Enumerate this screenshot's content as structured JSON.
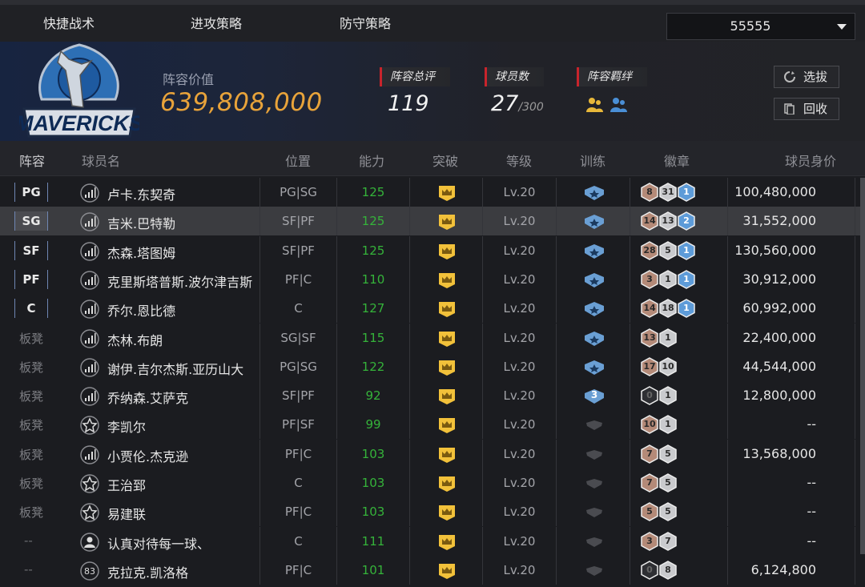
{
  "tabs": [
    "快捷战术",
    "进攻策略",
    "防守策略"
  ],
  "selector": {
    "value": "55555"
  },
  "team": {
    "value_label": "阵容价值",
    "value": "639,808,000",
    "stats": [
      {
        "label": "阵容总评",
        "value": "119"
      },
      {
        "label": "球员数",
        "value": "27",
        "sub": "/300"
      },
      {
        "label": "阵容羁绊"
      }
    ],
    "buttons": {
      "draft": "选拔",
      "recycle": "回收"
    }
  },
  "columns": [
    "阵容",
    "球员名",
    "位置",
    "能力",
    "突破",
    "等级",
    "训练",
    "徽章",
    "球员身价"
  ],
  "colors": {
    "accent": "#e8a33a",
    "ability": "#35b33a",
    "crown": "#f2c13a",
    "train_blue": "#6a9fd4",
    "train_dark": "#5a5b60",
    "stat_bar": "#c8242c"
  },
  "rows": [
    {
      "slot": "PG",
      "slot_type": "badge",
      "icon": "signal-icon",
      "name": "卢卡.东契奇",
      "pos": "PG|SG",
      "ability": "125",
      "level": "Lv.20",
      "train": "blue",
      "train_num": "",
      "badges": [
        {
          "n": "8",
          "c": "bronze"
        },
        {
          "n": "31",
          "c": "silver"
        },
        {
          "n": "1",
          "c": "blue"
        }
      ],
      "price": "100,480,000"
    },
    {
      "slot": "SG",
      "slot_type": "badge",
      "icon": "signal-icon",
      "name": "吉米.巴特勒",
      "pos": "SF|PF",
      "ability": "125",
      "level": "Lv.20",
      "train": "blue",
      "train_num": "",
      "badges": [
        {
          "n": "14",
          "c": "bronze"
        },
        {
          "n": "13",
          "c": "silver"
        },
        {
          "n": "2",
          "c": "blue"
        }
      ],
      "price": "31,552,000"
    },
    {
      "slot": "SF",
      "slot_type": "badge",
      "icon": "signal-icon",
      "name": "杰森.塔图姆",
      "pos": "SF|PF",
      "ability": "125",
      "level": "Lv.20",
      "train": "blue",
      "train_num": "",
      "badges": [
        {
          "n": "28",
          "c": "bronze"
        },
        {
          "n": "5",
          "c": "silver"
        },
        {
          "n": "1",
          "c": "blue"
        }
      ],
      "price": "130,560,000"
    },
    {
      "slot": "PF",
      "slot_type": "badge",
      "icon": "signal-icon",
      "name": "克里斯塔普斯.波尔津吉斯",
      "pos": "PF|C",
      "ability": "110",
      "level": "Lv.20",
      "train": "blue",
      "train_num": "",
      "badges": [
        {
          "n": "3",
          "c": "bronze"
        },
        {
          "n": "1",
          "c": "silver"
        },
        {
          "n": "1",
          "c": "blue"
        }
      ],
      "price": "30,912,000"
    },
    {
      "slot": "C",
      "slot_type": "badge",
      "icon": "signal-icon",
      "name": "乔尔.恩比德",
      "pos": "C",
      "ability": "127",
      "level": "Lv.20",
      "train": "blue",
      "train_num": "",
      "badges": [
        {
          "n": "14",
          "c": "bronze"
        },
        {
          "n": "18",
          "c": "silver"
        },
        {
          "n": "1",
          "c": "blue"
        }
      ],
      "price": "60,992,000"
    },
    {
      "slot": "板凳",
      "slot_type": "bench",
      "icon": "signal-icon",
      "name": "杰林.布朗",
      "pos": "SG|SF",
      "ability": "115",
      "level": "Lv.20",
      "train": "blue",
      "train_num": "",
      "badges": [
        {
          "n": "13",
          "c": "bronze"
        },
        {
          "n": "1",
          "c": "silver"
        }
      ],
      "price": "22,400,000"
    },
    {
      "slot": "板凳",
      "slot_type": "bench",
      "icon": "signal-icon",
      "name": "谢伊.吉尔杰斯.亚历山大",
      "pos": "PG|SG",
      "ability": "122",
      "level": "Lv.20",
      "train": "blue",
      "train_num": "",
      "badges": [
        {
          "n": "17",
          "c": "bronze"
        },
        {
          "n": "10",
          "c": "silver"
        }
      ],
      "price": "44,544,000"
    },
    {
      "slot": "板凳",
      "slot_type": "bench",
      "icon": "signal-icon",
      "name": "乔纳森.艾萨克",
      "pos": "SF|PF",
      "ability": "92",
      "level": "Lv.20",
      "train": "blue",
      "train_num": "3",
      "badges": [
        {
          "n": "0",
          "c": "dark"
        },
        {
          "n": "1",
          "c": "silver"
        }
      ],
      "price": "12,800,000"
    },
    {
      "slot": "板凳",
      "slot_type": "bench",
      "icon": "star-icon",
      "name": "李凯尔",
      "pos": "PF|SF",
      "ability": "99",
      "level": "Lv.20",
      "train": "dark",
      "train_num": "",
      "badges": [
        {
          "n": "10",
          "c": "bronze"
        },
        {
          "n": "1",
          "c": "silver"
        }
      ],
      "price": "--"
    },
    {
      "slot": "板凳",
      "slot_type": "bench",
      "icon": "signal-icon",
      "name": "小贾伦.杰克逊",
      "pos": "PF|C",
      "ability": "103",
      "level": "Lv.20",
      "train": "dark",
      "train_num": "",
      "badges": [
        {
          "n": "7",
          "c": "bronze"
        },
        {
          "n": "5",
          "c": "silver"
        }
      ],
      "price": "13,568,000"
    },
    {
      "slot": "板凳",
      "slot_type": "bench",
      "icon": "star-icon",
      "name": "王治郅",
      "pos": "C",
      "ability": "103",
      "level": "Lv.20",
      "train": "dark",
      "train_num": "",
      "badges": [
        {
          "n": "7",
          "c": "bronze"
        },
        {
          "n": "5",
          "c": "silver"
        }
      ],
      "price": "--"
    },
    {
      "slot": "板凳",
      "slot_type": "bench",
      "icon": "star-icon",
      "name": "易建联",
      "pos": "PF|C",
      "ability": "103",
      "level": "Lv.20",
      "train": "dark",
      "train_num": "",
      "badges": [
        {
          "n": "5",
          "c": "bronze"
        },
        {
          "n": "5",
          "c": "silver"
        }
      ],
      "price": "--"
    },
    {
      "slot": "--",
      "slot_type": "dash",
      "icon": "user-icon",
      "name": "认真对待每一球、",
      "pos": "C",
      "ability": "111",
      "level": "Lv.20",
      "train": "dark",
      "train_num": "",
      "badges": [
        {
          "n": "3",
          "c": "bronze"
        },
        {
          "n": "7",
          "c": "silver"
        }
      ],
      "price": "--"
    },
    {
      "slot": "--",
      "slot_type": "dash",
      "icon": "number-icon",
      "icon_text": "83",
      "name": "克拉克.凯洛格",
      "pos": "PF|C",
      "ability": "101",
      "level": "Lv.20",
      "train": "dark",
      "train_num": "",
      "badges": [
        {
          "n": "0",
          "c": "dark"
        },
        {
          "n": "8",
          "c": "silver"
        }
      ],
      "price": "6,124,800"
    }
  ]
}
